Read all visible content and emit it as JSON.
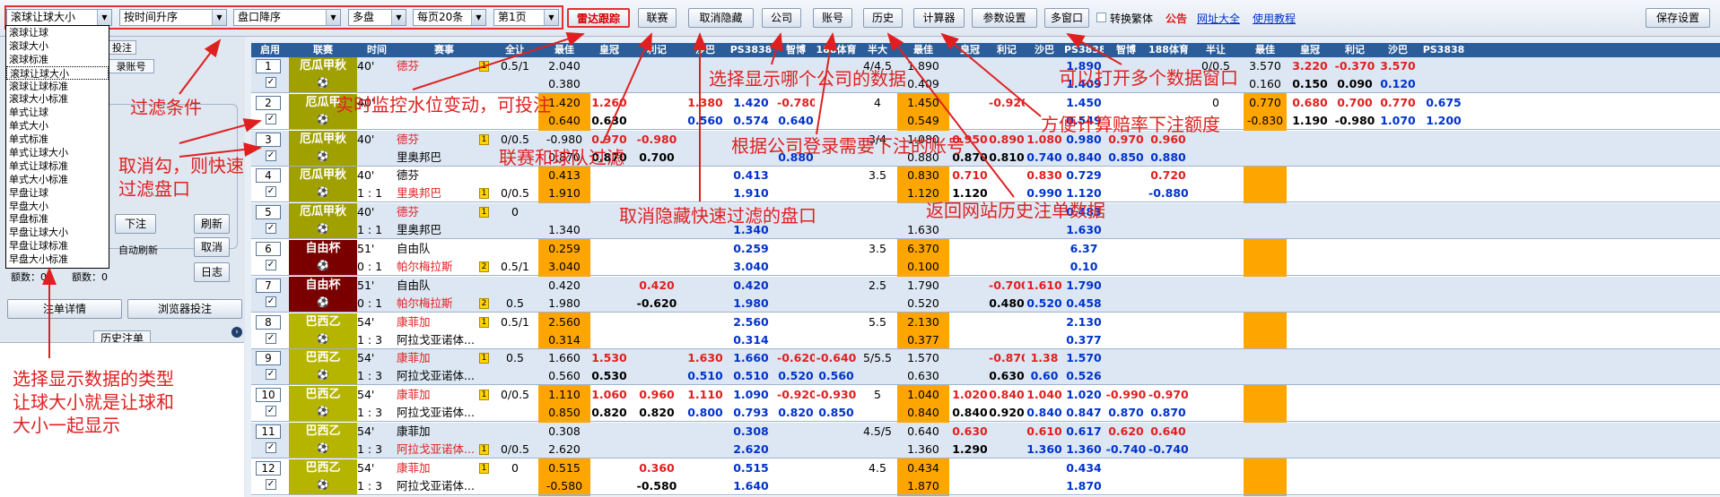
{
  "toolbar": {
    "type_select": "滚球让球大小",
    "sort_time": "按时间升序",
    "sort_handicap": "盘口降序",
    "market": "多盘",
    "per_page": "每页20条",
    "page": "第1页",
    "buttons": [
      "雷达跟踪",
      "联赛",
      "取消隐藏",
      "公司",
      "账号",
      "历史",
      "计算器",
      "参数设置",
      "多窗口"
    ],
    "traditional_label": "转换繁体",
    "notice": "公告",
    "site_link": "网址大全",
    "tutorial_link": "使用教程",
    "save_label": "保存设置"
  },
  "dropdown_options": [
    "滚球让球",
    "滚球大小",
    "滚球标准",
    "滚球让球大小",
    "滚球让球标准",
    "滚球大小标准",
    "单式让球",
    "单式大小",
    "单式标准",
    "单式让球大小",
    "单式让球标准",
    "单式大小标准",
    "早盘让球",
    "早盘大小",
    "早盘标准",
    "早盘让球大小",
    "早盘让球标准",
    "早盘大小标准"
  ],
  "left_panel": {
    "tab_bet": "投注",
    "tab_account": "录账号",
    "bet_btn": "下注",
    "refresh_btn": "刷新",
    "auto_refresh": "自动刷新",
    "cancel_btn": "取消",
    "log_btn": "日志",
    "amount1": "额数：0",
    "amount2": "额数：0",
    "bet_detail": "注单详情",
    "browser_bet": "浏览器投注",
    "history": "历史注单"
  },
  "annotations": {
    "filter": "过滤条件",
    "uncheck": "取消勾，则快速\n过滤盘口",
    "type_help": "选择显示数据的类型\n让球大小就是让球和\n大小一起显示",
    "realtime": "实时监控水位变动，可投注",
    "league_filter": "联赛和球队过滤",
    "unhide": "取消隐藏快速过滤的盘口",
    "company": "选择显示哪个公司的数据",
    "account": "根据公司登录需要下注的账号",
    "multi": "可以打开多个数据窗口",
    "calc": "方便计算赔率下注额度",
    "history": "返回网站历史注单数据"
  },
  "columns": [
    "启用",
    "联赛",
    "时间",
    "赛事",
    "全让",
    "最佳",
    "皇冠",
    "利记",
    "沙巴",
    "PS3838",
    "智博",
    "188体育",
    "半大",
    "最佳",
    "皇冠",
    "利记",
    "沙巴",
    "PS3838",
    "智博",
    "188体育",
    "半让",
    "最佳",
    "皇冠",
    "利记",
    "沙巴",
    "PS3838"
  ],
  "colors": {
    "header": "#2a5d99",
    "orange": "#ffa500",
    "olive": "#a0a000",
    "maroon": "#7a0000",
    "lime": "#b5b500"
  },
  "rows": [
    {
      "no": "1",
      "league": "厄瓜甲秋",
      "lc": "olive",
      "time": "40'",
      "score": "",
      "home": "德芬",
      "away": "",
      "hr": true,
      "ar": false,
      "badge": "1",
      "hcap1": "0.5/1",
      "hcap2": "",
      "best1": "2.040",
      "best2": "0.380",
      "hg1": "",
      "hg2": "",
      "lj1": "",
      "lj2": "",
      "sb1": "",
      "sb2": "",
      "ps1": "",
      "ps2": "",
      "zb1": "",
      "zb2": "",
      "s188a": "",
      "s188b": "",
      "tot1": "4/4.5",
      "tot2": "",
      "b2a": "1.890",
      "b2b": "0.409",
      "hg21": "",
      "hg22": "",
      "lj21": "",
      "lj22": "",
      "sb21": "",
      "sb22": "",
      "ps21": "1.890",
      "ps22": "1.409",
      "zb21": "",
      "zb22": "",
      "s21": "",
      "s22": "",
      "half1": "0/0.5",
      "half2": "",
      "b3a": "3.570",
      "b3b": "0.160",
      "hg31": "3.220",
      "hg32": "0.150",
      "lj31": "-0.370",
      "lj32": "0.090",
      "sb31": "3.570",
      "sb32": "0.120",
      "ps31": "",
      "ps32": ""
    },
    {
      "no": "2",
      "league": "厄瓜甲",
      "lc": "olive",
      "time": "40'",
      "score": "",
      "home": "",
      "away": "",
      "hr": false,
      "ar": false,
      "badge": "",
      "hcap1": "",
      "hcap2": "",
      "best1": "1.420",
      "best2": "0.640",
      "hg1": "1.260",
      "hg2": "0.630",
      "lj1": "",
      "lj2": "",
      "sb1": "1.380",
      "sb2": "0.560",
      "ps1": "1.420",
      "ps2": "0.574",
      "zb1": "-0.780",
      "zb2": "0.640",
      "s188a": "",
      "s188b": "",
      "tot1": "4",
      "tot2": "",
      "b2a": "1.450",
      "b2b": "0.549",
      "hg21": "",
      "hg22": "",
      "lj21": "-0.920",
      "lj22": "",
      "sb21": "",
      "sb22": "",
      "ps21": "1.450",
      "ps22": "0.549",
      "zb21": "",
      "zb22": "",
      "s21": "",
      "s22": "",
      "half1": "0",
      "half2": "",
      "b3a": "0.770",
      "b3b": "-0.830",
      "hg31": "0.680",
      "hg32": "1.190",
      "lj31": "0.700",
      "lj32": "-0.980",
      "sb31": "0.770",
      "sb32": "1.070",
      "ps31": "0.675",
      "ps32": "1.200"
    },
    {
      "no": "3",
      "league": "厄瓜甲秋",
      "lc": "olive",
      "time": "40'",
      "score": "",
      "home": "德芬",
      "away": "里奥邦巴",
      "hr": true,
      "ar": false,
      "badge": "1",
      "hcap1": "0/0.5",
      "hcap2": "",
      "best1": "-0.980",
      "best2": "0.870",
      "hg1": "0.970",
      "hg2": "0.870",
      "lj1": "-0.980",
      "lj2": "0.700",
      "sb1": "",
      "sb2": "",
      "ps1": "",
      "ps2": "",
      "zb1": "",
      "zb2": "0.880",
      "s188a": "",
      "s188b": "",
      "tot1": "3/4",
      "tot2": "",
      "b2a": "1.080",
      "b2b": "0.880",
      "hg21": "0.950",
      "hg22": "0.870",
      "lj21": "0.890",
      "lj22": "0.810",
      "sb21": "1.080",
      "sb22": "0.740",
      "ps21": "0.980",
      "ps22": "0.840",
      "zb21": "0.970",
      "zb22": "0.850",
      "s21": "0.960",
      "s22": "0.880",
      "half1": "",
      "half2": "",
      "b3a": "",
      "b3b": "",
      "hg31": "",
      "hg32": "",
      "lj31": "",
      "lj32": "",
      "sb31": "",
      "sb32": "",
      "ps31": "",
      "ps32": ""
    },
    {
      "no": "4",
      "league": "厄瓜甲秋",
      "lc": "olive",
      "time": "40'",
      "score": "1 : 1",
      "home": "德芬",
      "away": "里奥邦巴",
      "hr": false,
      "ar": true,
      "badge": "1",
      "hcap1": "",
      "hcap2": "0/0.5",
      "best1": "0.413",
      "best2": "1.910",
      "hg1": "",
      "hg2": "",
      "lj1": "",
      "lj2": "",
      "sb1": "",
      "sb2": "",
      "ps1": "0.413",
      "ps2": "1.910",
      "zb1": "",
      "zb2": "",
      "s188a": "",
      "s188b": "",
      "tot1": "3.5",
      "tot2": "",
      "b2a": "0.830",
      "b2b": "1.120",
      "hg21": "0.710",
      "hg22": "1.120",
      "lj21": "",
      "lj22": "",
      "sb21": "0.830",
      "sb22": "0.990",
      "ps21": "0.729",
      "ps22": "1.120",
      "zb21": "",
      "zb22": "",
      "s21": "0.720",
      "s22": "-0.880",
      "half1": "",
      "half2": "",
      "b3a": "",
      "b3b": "",
      "hg31": "",
      "hg32": "",
      "lj31": "",
      "lj32": "",
      "sb31": "",
      "sb32": "",
      "ps31": "",
      "ps32": ""
    },
    {
      "no": "5",
      "league": "厄瓜甲秋",
      "lc": "olive",
      "time": "40'",
      "score": "1 : 1",
      "home": "德芬",
      "away": "里奥邦巴",
      "hr": true,
      "ar": false,
      "badge": "1",
      "hcap1": "0",
      "hcap2": "",
      "best1": "",
      "best2": "1.340",
      "hg1": "",
      "hg2": "",
      "lj1": "",
      "lj2": "",
      "sb1": "",
      "sb2": "",
      "ps1": "",
      "ps2": "1.340",
      "zb1": "",
      "zb2": "",
      "s188a": "",
      "s188b": "",
      "tot1": "",
      "tot2": "",
      "b2a": "",
      "b2b": "1.630",
      "hg21": "",
      "hg22": "",
      "lj21": "",
      "lj22": "",
      "sb21": "",
      "sb22": "",
      "ps21": "0.483",
      "ps22": "1.630",
      "zb21": "",
      "zb22": "",
      "s21": "",
      "s22": "",
      "half1": "",
      "half2": "",
      "b3a": "",
      "b3b": "",
      "hg31": "",
      "hg32": "",
      "lj31": "",
      "lj32": "",
      "sb31": "",
      "sb32": "",
      "ps31": "",
      "ps32": ""
    },
    {
      "no": "6",
      "league": "自由杯",
      "lc": "maroon",
      "time": "51'",
      "score": "0 : 1",
      "home": "自由队",
      "away": "帕尔梅拉斯",
      "hr": false,
      "ar": true,
      "badge": "2",
      "hcap1": "",
      "hcap2": "0.5/1",
      "best1": "0.259",
      "best2": "3.040",
      "hg1": "",
      "hg2": "",
      "lj1": "",
      "lj2": "",
      "sb1": "",
      "sb2": "",
      "ps1": "0.259",
      "ps2": "3.040",
      "zb1": "",
      "zb2": "",
      "s188a": "",
      "s188b": "",
      "tot1": "3.5",
      "tot2": "",
      "b2a": "6.370",
      "b2b": "0.100",
      "hg21": "",
      "hg22": "",
      "lj21": "",
      "lj22": "",
      "sb21": "",
      "sb22": "",
      "ps21": "6.37",
      "ps22": "0.10",
      "zb21": "",
      "zb22": "",
      "s21": "",
      "s22": "",
      "half1": "",
      "half2": "",
      "b3a": "",
      "b3b": "",
      "hg31": "",
      "hg32": "",
      "lj31": "",
      "lj32": "",
      "sb31": "",
      "sb32": "",
      "ps31": "",
      "ps32": ""
    },
    {
      "no": "7",
      "league": "自由杯",
      "lc": "maroon",
      "time": "51'",
      "score": "0 : 1",
      "home": "自由队",
      "away": "帕尔梅拉斯",
      "hr": false,
      "ar": true,
      "badge": "2",
      "hcap1": "",
      "hcap2": "0.5",
      "best1": "0.420",
      "best2": "1.980",
      "hg1": "",
      "hg2": "",
      "lj1": "0.420",
      "lj2": "-0.620",
      "sb1": "",
      "sb2": "",
      "ps1": "0.420",
      "ps2": "1.980",
      "zb1": "",
      "zb2": "",
      "s188a": "",
      "s188b": "",
      "tot1": "2.5",
      "tot2": "",
      "b2a": "1.790",
      "b2b": "0.520",
      "hg21": "",
      "hg22": "",
      "lj21": "-0.700",
      "lj22": "0.480",
      "sb21": "1.610",
      "sb22": "0.520",
      "ps21": "1.790",
      "ps22": "0.458",
      "zb21": "",
      "zb22": "",
      "s21": "",
      "s22": "",
      "half1": "",
      "half2": "",
      "b3a": "",
      "b3b": "",
      "hg31": "",
      "hg32": "",
      "lj31": "",
      "lj32": "",
      "sb31": "",
      "sb32": "",
      "ps31": "",
      "ps32": ""
    },
    {
      "no": "8",
      "league": "巴西乙",
      "lc": "lime",
      "time": "54'",
      "score": "1 : 3",
      "home": "康菲加",
      "away": "阿拉戈亚诺体...",
      "hr": true,
      "ar": false,
      "badge": "1",
      "hcap1": "0.5/1",
      "hcap2": "",
      "best1": "2.560",
      "best2": "0.314",
      "hg1": "",
      "hg2": "",
      "lj1": "",
      "lj2": "",
      "sb1": "",
      "sb2": "",
      "ps1": "2.560",
      "ps2": "0.314",
      "zb1": "",
      "zb2": "",
      "s188a": "",
      "s188b": "",
      "tot1": "5.5",
      "tot2": "",
      "b2a": "2.130",
      "b2b": "0.377",
      "hg21": "",
      "hg22": "",
      "lj21": "",
      "lj22": "",
      "sb21": "",
      "sb22": "",
      "ps21": "2.130",
      "ps22": "0.377",
      "zb21": "",
      "zb22": "",
      "s21": "",
      "s22": "",
      "half1": "",
      "half2": "",
      "b3a": "",
      "b3b": "",
      "hg31": "",
      "hg32": "",
      "lj31": "",
      "lj32": "",
      "sb31": "",
      "sb32": "",
      "ps31": "",
      "ps32": ""
    },
    {
      "no": "9",
      "league": "巴西乙",
      "lc": "lime",
      "time": "54'",
      "score": "1 : 3",
      "home": "康菲加",
      "away": "阿拉戈亚诺体...",
      "hr": true,
      "ar": false,
      "badge": "1",
      "hcap1": "0.5",
      "hcap2": "",
      "best1": "1.660",
      "best2": "0.560",
      "hg1": "1.530",
      "hg2": "0.530",
      "lj1": "",
      "lj2": "",
      "sb1": "1.630",
      "sb2": "0.510",
      "ps1": "1.660",
      "ps2": "0.510",
      "zb1": "-0.620",
      "zb2": "0.520",
      "s188a": "-0.640",
      "s188b": "0.560",
      "tot1": "5/5.5",
      "tot2": "",
      "b2a": "1.570",
      "b2b": "0.630",
      "hg21": "",
      "hg22": "",
      "lj21": "-0.870",
      "lj22": "0.630",
      "sb21": "1.38",
      "sb22": "0.60",
      "ps21": "1.570",
      "ps22": "0.526",
      "zb21": "",
      "zb22": "",
      "s21": "",
      "s22": "",
      "half1": "",
      "half2": "",
      "b3a": "",
      "b3b": "",
      "hg31": "",
      "hg32": "",
      "lj31": "",
      "lj32": "",
      "sb31": "",
      "sb32": "",
      "ps31": "",
      "ps32": ""
    },
    {
      "no": "10",
      "league": "巴西乙",
      "lc": "lime",
      "time": "54'",
      "score": "1 : 3",
      "home": "康菲加",
      "away": "阿拉戈亚诺体...",
      "hr": true,
      "ar": false,
      "badge": "1",
      "hcap1": "0/0.5",
      "hcap2": "",
      "best1": "1.110",
      "best2": "0.850",
      "hg1": "1.060",
      "hg2": "0.820",
      "lj1": "0.960",
      "lj2": "0.820",
      "sb1": "1.110",
      "sb2": "0.800",
      "ps1": "1.090",
      "ps2": "0.793",
      "zb1": "-0.920",
      "zb2": "0.820",
      "s188a": "-0.930",
      "s188b": "0.850",
      "tot1": "5",
      "tot2": "",
      "b2a": "1.040",
      "b2b": "0.840",
      "hg21": "1.020",
      "hg22": "0.840",
      "lj21": "0.840",
      "lj22": "0.920",
      "sb21": "1.040",
      "sb22": "0.840",
      "ps21": "1.020",
      "ps22": "0.847",
      "zb21": "-0.990",
      "zb22": "0.870",
      "s21": "-0.970",
      "s22": "0.870",
      "half1": "",
      "half2": "",
      "b3a": "",
      "b3b": "",
      "hg31": "",
      "hg32": "",
      "lj31": "",
      "lj32": "",
      "sb31": "",
      "sb32": "",
      "ps31": "",
      "ps32": ""
    },
    {
      "no": "11",
      "league": "巴西乙",
      "lc": "lime",
      "time": "54'",
      "score": "1 : 3",
      "home": "康菲加",
      "away": "阿拉戈亚诺体...",
      "hr": false,
      "ar": true,
      "badge": "1",
      "hcap1": "",
      "hcap2": "0/0.5",
      "best1": "0.308",
      "best2": "2.620",
      "hg1": "",
      "hg2": "",
      "lj1": "",
      "lj2": "",
      "sb1": "",
      "sb2": "",
      "ps1": "0.308",
      "ps2": "2.620",
      "zb1": "",
      "zb2": "",
      "s188a": "",
      "s188b": "",
      "tot1": "4.5/5",
      "tot2": "",
      "b2a": "0.640",
      "b2b": "1.360",
      "hg21": "0.630",
      "hg22": "1.290",
      "lj21": "",
      "lj22": "",
      "sb21": "0.610",
      "sb22": "1.360",
      "ps21": "0.617",
      "ps22": "1.360",
      "zb21": "0.620",
      "zb22": "-0.740",
      "s21": "0.640",
      "s22": "-0.740",
      "half1": "",
      "half2": "",
      "b3a": "",
      "b3b": "",
      "hg31": "",
      "hg32": "",
      "lj31": "",
      "lj32": "",
      "sb31": "",
      "sb32": "",
      "ps31": "",
      "ps32": ""
    },
    {
      "no": "12",
      "league": "巴西乙",
      "lc": "lime",
      "time": "54'",
      "score": "1 : 3",
      "home": "康菲加",
      "away": "阿拉戈亚诺体...",
      "hr": true,
      "ar": false,
      "badge": "1",
      "hcap1": "0",
      "hcap2": "",
      "best1": "0.515",
      "best2": "-0.580",
      "hg1": "",
      "hg2": "",
      "lj1": "0.360",
      "lj2": "-0.580",
      "sb1": "",
      "sb2": "",
      "ps1": "0.515",
      "ps2": "1.640",
      "zb1": "",
      "zb2": "",
      "s188a": "",
      "s188b": "",
      "tot1": "4.5",
      "tot2": "",
      "b2a": "0.434",
      "b2b": "1.870",
      "hg21": "",
      "hg22": "",
      "lj21": "",
      "lj22": "",
      "sb21": "",
      "sb22": "",
      "ps21": "0.434",
      "ps22": "1.870",
      "zb21": "",
      "zb22": "",
      "s21": "",
      "s22": "",
      "half1": "",
      "half2": "",
      "b3a": "",
      "b3b": "",
      "hg31": "",
      "hg32": "",
      "lj31": "",
      "lj32": "",
      "sb31": "",
      "sb32": "",
      "ps31": "",
      "ps32": ""
    }
  ]
}
